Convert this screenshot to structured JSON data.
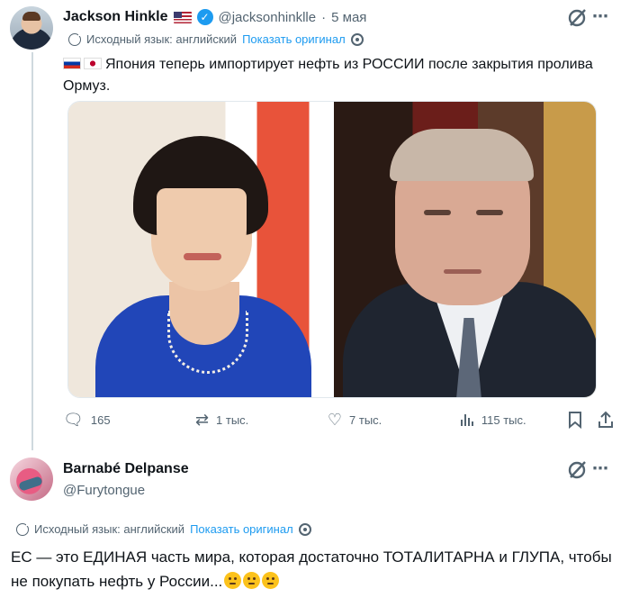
{
  "tweet": {
    "author_name": "Jackson Hinkle",
    "author_handle": "@jacksonhinklle",
    "separator": "·",
    "date": "5 мая",
    "translate": {
      "label": "Исходный язык: английский",
      "show_original": "Показать оригинал"
    },
    "text": "Япония теперь импортирует нефть из РОССИИ после закрытия пролива Ормуз.",
    "stats": {
      "replies": "165",
      "reposts": "1 тыс.",
      "likes": "7 тыс.",
      "views": "115 тыс."
    }
  },
  "reply": {
    "author_name": "Barnabé Delpanse",
    "author_handle": "@Furytongue",
    "translate": {
      "label": "Исходный язык: английский",
      "show_original": "Показать оригинал"
    },
    "text": "ЕС — это ЕДИНАЯ часть мира, которая достаточно ТОТАЛИТАРНА и ГЛУПА, чтобы не покупать нефть у России..."
  },
  "icons": {
    "verified": "verified-badge-icon",
    "grok": "grok-icon",
    "reply": "reply-icon",
    "repost": "repost-icon",
    "like": "heart-icon",
    "views": "views-icon",
    "bookmark": "bookmark-icon",
    "share": "share-icon"
  },
  "colors": {
    "accent": "#1d9bf0",
    "muted": "#536471",
    "text": "#0f1419"
  }
}
